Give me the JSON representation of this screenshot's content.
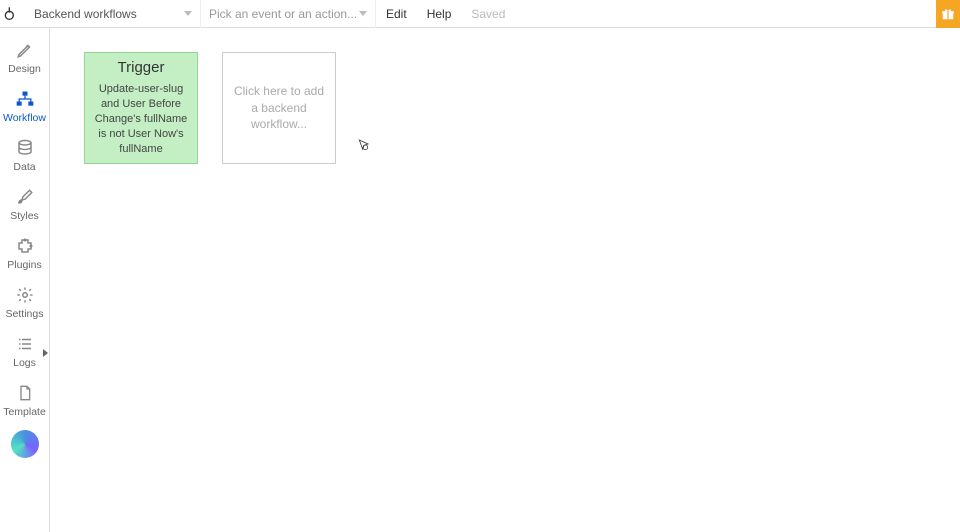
{
  "topbar": {
    "page_dropdown": "Backend workflows",
    "event_dropdown_placeholder": "Pick an event or an action...",
    "edit": "Edit",
    "help": "Help",
    "saved": "Saved"
  },
  "sidebar": {
    "design": "Design",
    "workflow": "Workflow",
    "data": "Data",
    "styles": "Styles",
    "plugins": "Plugins",
    "settings": "Settings",
    "logs": "Logs",
    "template": "Template"
  },
  "canvas": {
    "trigger_title": "Trigger",
    "trigger_desc": "Update-user-slug and User Before Change's fullName is not User Now's fullName",
    "add_workflow": "Click here to add a backend workflow..."
  }
}
